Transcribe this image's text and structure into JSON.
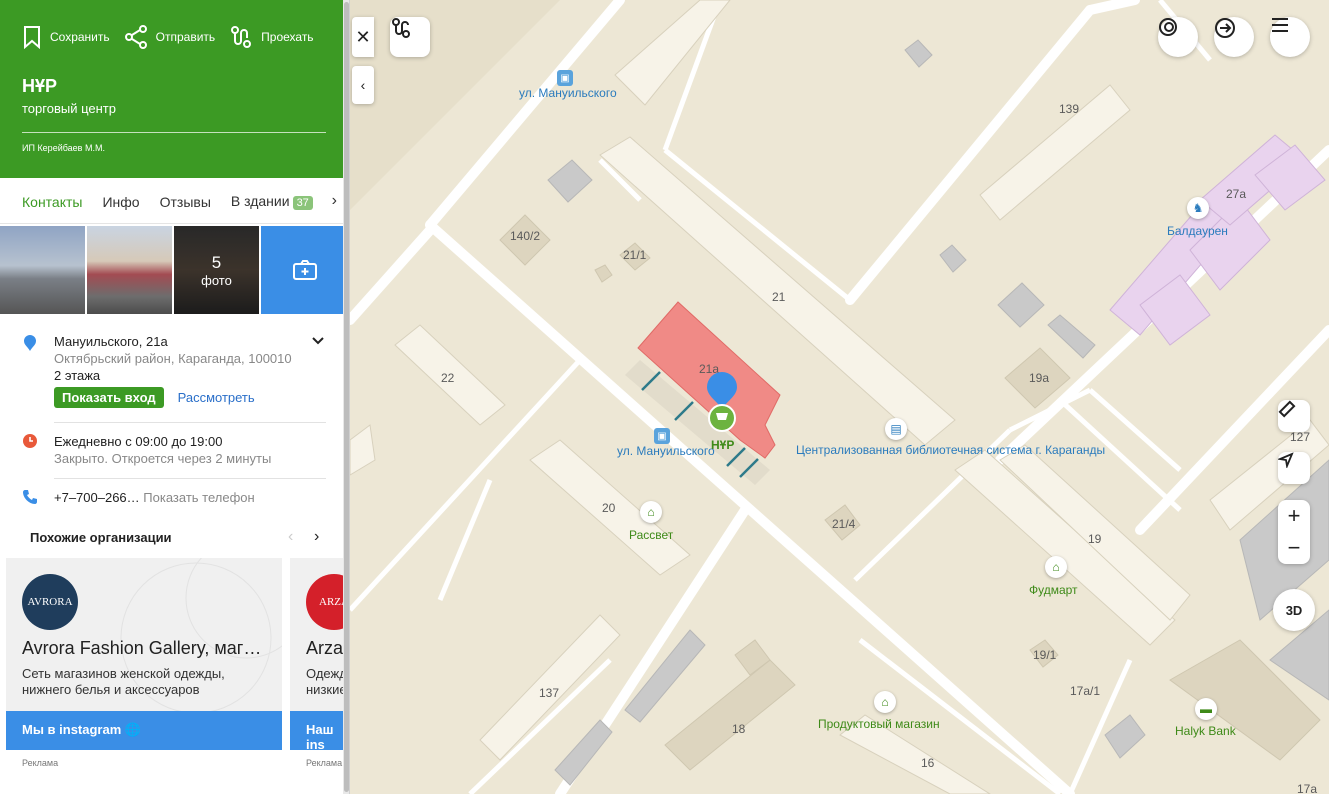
{
  "header": {
    "actions": {
      "save": "Сохранить",
      "share": "Отправить",
      "route": "Проехать"
    },
    "title": "НҰР",
    "subtitle": "торговый центр",
    "owner": "ИП Керейбаев М.М.",
    "color": "#3c9a24"
  },
  "tabs": [
    {
      "label": "Контакты",
      "active": true
    },
    {
      "label": "Инфо"
    },
    {
      "label": "Отзывы"
    },
    {
      "label": "В здании",
      "badge": "37"
    }
  ],
  "photos": {
    "count": "5",
    "count_label": "фото"
  },
  "address": {
    "street": "Мануильского, 21а",
    "district": "Октябрьский район, Караганда, 100010",
    "floors": "2 этажа",
    "entrance_button": "Показать вход",
    "view_link": "Рассмотреть"
  },
  "hours": {
    "schedule": "Ежедневно с 09:00 до 19:00",
    "status": "Закрыто. Откроется через 2 минуты"
  },
  "phone": {
    "number": "+7‒700‒266…",
    "show_label": "Показать телефон"
  },
  "similar": {
    "title": "Похожие организации",
    "cards": [
      {
        "logo": "AVRORA",
        "name": "Avrora Fashion Gallery, маг…",
        "desc": "Сеть магазинов женской одежды, нижнего белья и аксессуаров",
        "button": "Мы в instagram",
        "ad": "Реклама"
      },
      {
        "logo": "ARZA",
        "name": "Arzan",
        "desc": "Одежда низкие",
        "button": "Наш ins",
        "ad": "Реклама"
      }
    ]
  },
  "map": {
    "controls": {
      "zoom_in": "+",
      "zoom_out": "−",
      "three_d": "3D"
    },
    "building_labels": [
      "139",
      "27а",
      "140/2",
      "21/1",
      "21",
      "21а",
      "22",
      "19а",
      "127",
      "20",
      "21/4",
      "19",
      "19/1",
      "17а/1",
      "137",
      "18",
      "16",
      "17а"
    ],
    "street_labels": [
      "ул. Мануильского",
      "ул. Мануильского"
    ],
    "pois": {
      "nur": "НҰР",
      "library": "Централизованная библиотечная система г. Караганды",
      "baldauren": "Балдаурен",
      "rassvet": "Рассвет",
      "fudmart": "Фудмарт",
      "produkt": "Продуктовый магазин",
      "halyk": "Halyk Bank"
    }
  }
}
